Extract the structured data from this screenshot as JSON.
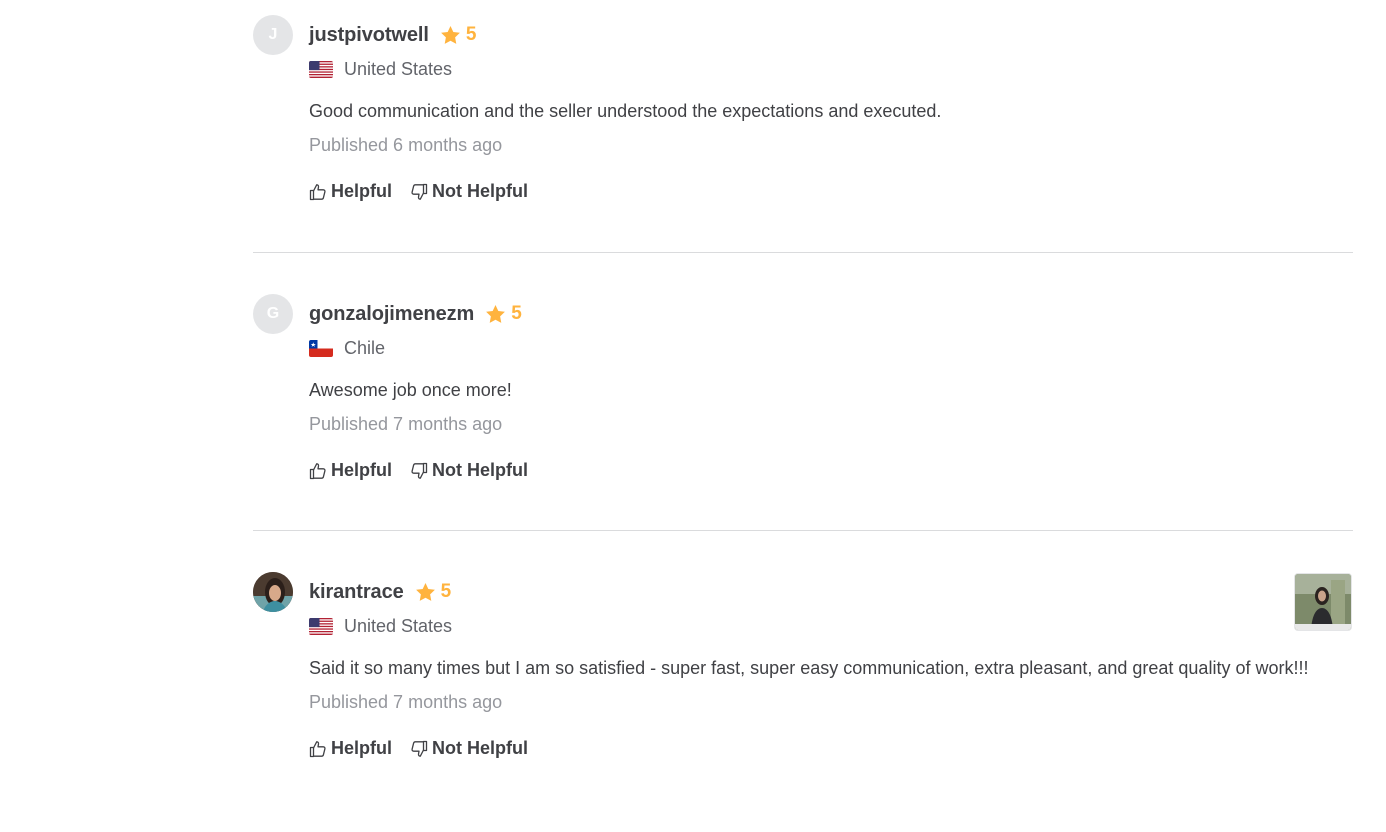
{
  "actions": {
    "helpful_label": "Helpful",
    "not_helpful_label": "Not Helpful"
  },
  "colors": {
    "star": "#ffb33e",
    "text": "#404145",
    "muted": "#95979d",
    "divider": "#dadbdd"
  },
  "reviews": [
    {
      "avatar_initial": "J",
      "username": "justpivotwell",
      "rating": "5",
      "country": "United States",
      "flag_icon": "us-flag-icon",
      "text": "Good communication and the seller understood the expectations and executed.",
      "published": "Published 6 months ago"
    },
    {
      "avatar_initial": "G",
      "username": "gonzalojimenezm",
      "rating": "5",
      "country": "Chile",
      "flag_icon": "chile-flag-icon",
      "text": "Awesome job once more!",
      "published": "Published 7 months ago"
    },
    {
      "avatar_initial": "",
      "username": "kirantrace",
      "rating": "5",
      "country": "United States",
      "flag_icon": "us-flag-icon",
      "text": "Said it so many times but I am so satisfied - super fast, super easy communication, extra pleasant, and great quality of work!!!",
      "published": "Published 7 months ago"
    }
  ]
}
